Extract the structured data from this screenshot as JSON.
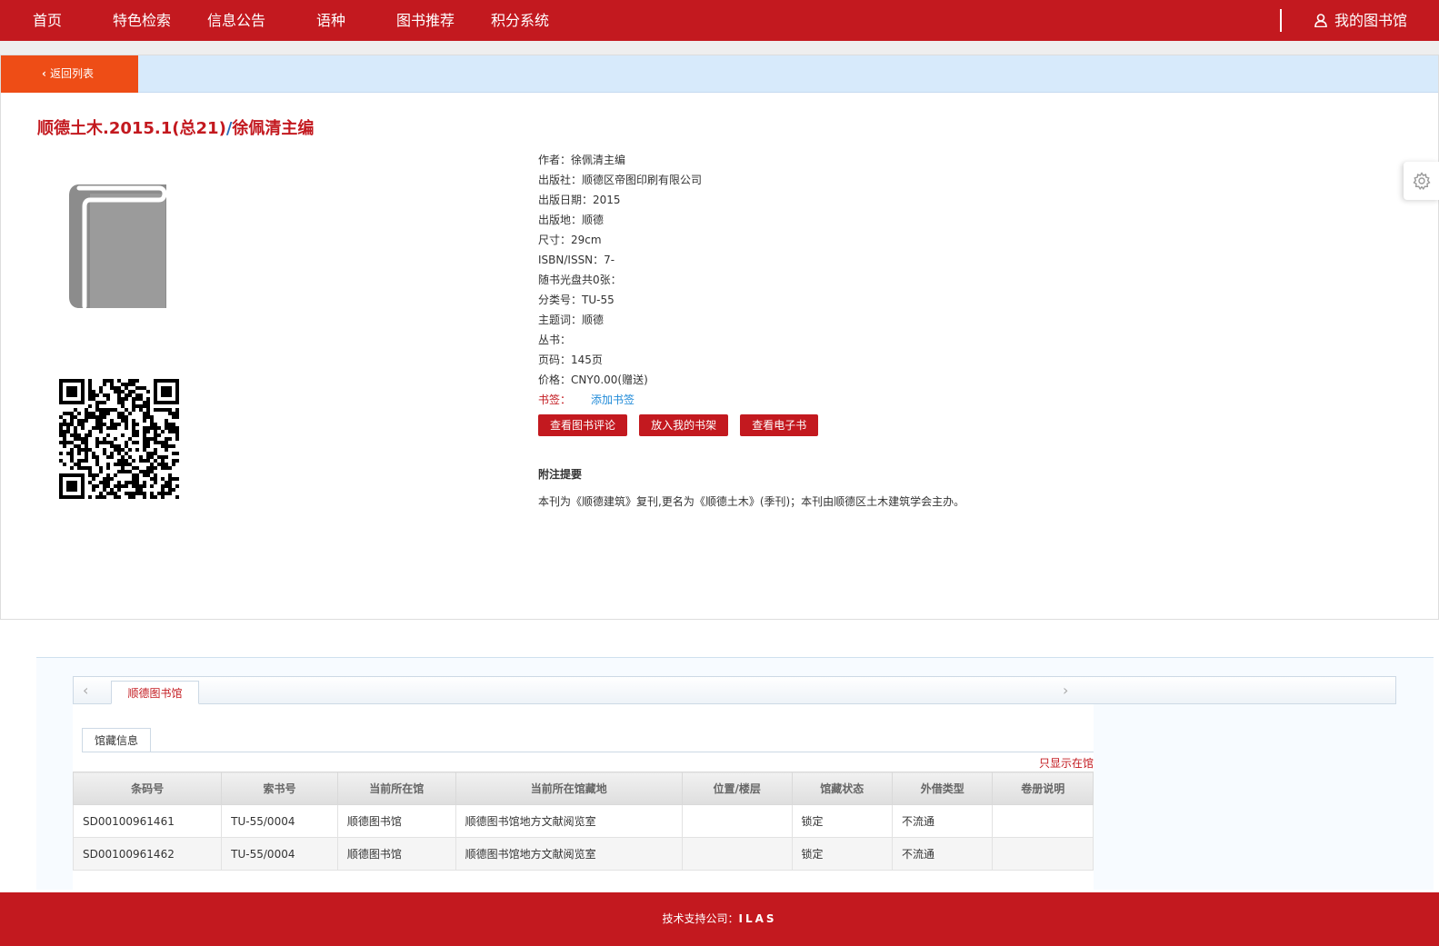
{
  "nav": {
    "items": [
      "首页",
      "特色检索",
      "信息公告",
      "语种",
      "图书推荐",
      "积分系统"
    ],
    "mylib": "我的图书馆"
  },
  "detail": {
    "back_label": "返回列表",
    "title_main": "顺德土木.2015.1(总21)",
    "title_sep": "/",
    "title_author": "徐佩清主编",
    "meta": [
      {
        "k": "作者：",
        "v": "徐佩清主编"
      },
      {
        "k": "出版社：",
        "v": "顺德区帝图印刷有限公司"
      },
      {
        "k": "出版日期：",
        "v": "2015"
      },
      {
        "k": "出版地：",
        "v": "顺德"
      },
      {
        "k": "尺寸：",
        "v": "29cm"
      },
      {
        "k": "ISBN/ISSN：",
        "v": "7-"
      },
      {
        "k": "随书光盘共0张：",
        "v": ""
      },
      {
        "k": "分类号：",
        "v": "TU-55"
      },
      {
        "k": "主题词：",
        "v": "顺德"
      },
      {
        "k": "丛书：",
        "v": ""
      },
      {
        "k": "页码：",
        "v": "145页"
      },
      {
        "k": "价格：",
        "v": "CNY0.00(赠送)"
      }
    ],
    "bookmark_key": "书签：",
    "bookmark_link": "添加书签",
    "buttons": [
      "查看图书评论",
      "放入我的书架",
      "查看电子书"
    ],
    "note_title": "附注提要",
    "note_body": "本刊为《顺德建筑》复刊,更名为《顺德土木》(季刊)；本刊由顺德区土木建筑学会主办。"
  },
  "holdings": {
    "library_tab": "顺德图书馆",
    "sub_tab": "馆藏信息",
    "only_in": "只显示在馆",
    "columns": [
      "条码号",
      "索书号",
      "当前所在馆",
      "当前所在馆藏地",
      "位置/楼层",
      "馆藏状态",
      "外借类型",
      "卷册说明"
    ],
    "rows": [
      [
        "SD00100961461",
        "TU-55/0004",
        "顺德图书馆",
        "顺德图书馆地方文献阅览室",
        "",
        "锁定",
        "不流通",
        ""
      ],
      [
        "SD00100961462",
        "TU-55/0004",
        "顺德图书馆",
        "顺德图书馆地方文献阅览室",
        "",
        "锁定",
        "不流通",
        ""
      ]
    ]
  },
  "footer": {
    "prefix": "技术支持公司：",
    "brand": "ILAS"
  },
  "colors": {
    "brand_red": "#c3191f",
    "back_orange": "#ee4d16",
    "link_blue": "#1f8ad8"
  }
}
